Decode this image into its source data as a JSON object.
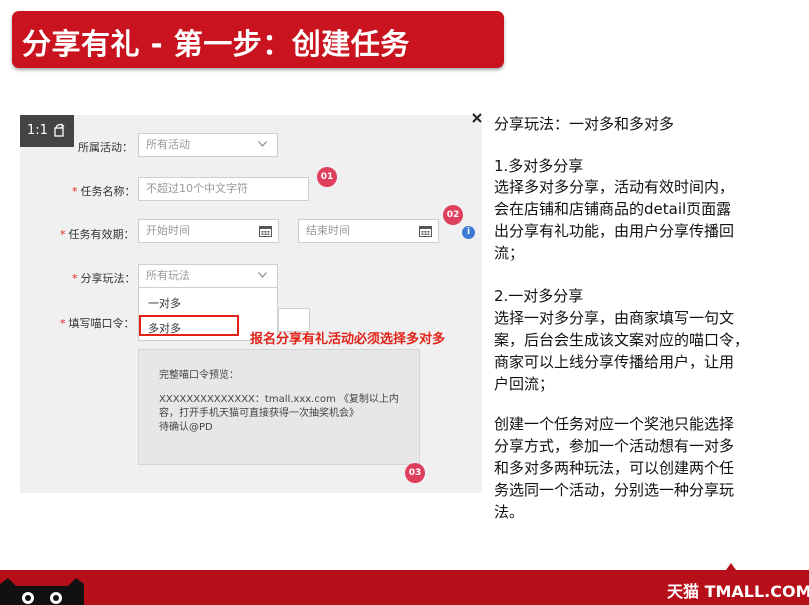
{
  "header": {
    "title": "分享有礼 - 第一步：创建任务"
  },
  "panel": {
    "zoom_label": "1:1",
    "form": {
      "activity_label": "所属活动：",
      "activity_value": "所有活动",
      "task_name_label": "任务名称：",
      "task_name_placeholder": "不超过10个中文字符",
      "validity_label": "任务有效期：",
      "start_placeholder": "开始时间",
      "end_placeholder": "结束时间",
      "share_mode_label": "分享玩法：",
      "share_mode_value": "所有玩法",
      "share_options": [
        "一对多",
        "多对多"
      ],
      "password_label": "填写喵口令："
    },
    "badges": [
      "01",
      "02",
      "03"
    ],
    "info_icon": "i",
    "annotation": "报名分享有礼活动必须选择多对多",
    "preview": {
      "title": "完整喵口令预览：",
      "lines": [
        "XXXXXXXXXXXXXX：tmall.xxx.com 《复制以上内",
        "容，打开手机天猫可直接获得一次抽奖机会》",
        "待确认@PD"
      ]
    }
  },
  "description": {
    "lines": [
      "分享玩法：一对多和多对多",
      "1.多对多分享",
      "选择多对多分享，活动有效时间内，",
      "会在店铺和店铺商品的detail页面露",
      "出分享有礼功能，由用户分享传播回",
      "流；",
      "2.一对多分享",
      "选择一对多分享，由商家填写一句文",
      "案，后台会生成该文案对应的喵口令，",
      "商家可以上线分享传播给用户，让用",
      "户回流；",
      "创建一个任务对应一个奖池只能选择",
      "分享方式，参加一个活动想有一对多",
      "和多对多两种玩法，可以创建两个任",
      "务选同一个活动，分别选一种分享玩",
      "法。"
    ]
  },
  "footer": {
    "brand": "天猫 TMALL.COM"
  },
  "colors": {
    "brand_red": "#c9131e",
    "annotation_red": "#e2231a",
    "badge_pink": "#dd3f5c",
    "info_blue": "#3d7ad6"
  }
}
